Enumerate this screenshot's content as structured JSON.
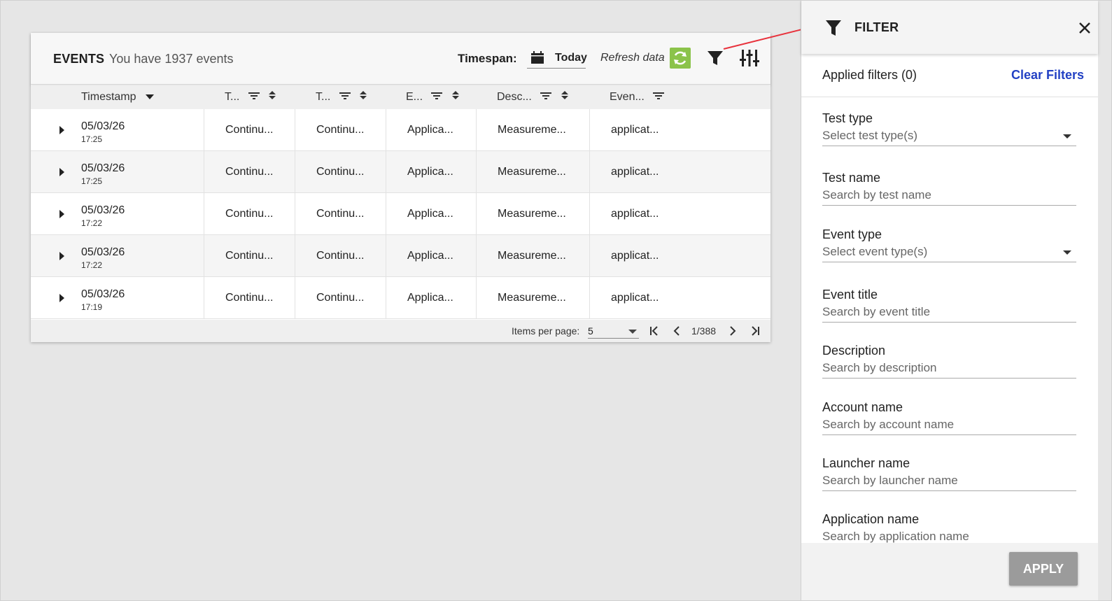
{
  "events": {
    "title": "EVENTS",
    "count_text": "You have 1937 events",
    "timespan_label": "Timespan:",
    "timespan_value": "Today",
    "refresh_label": "Refresh data"
  },
  "table": {
    "columns": [
      "Timestamp",
      "T...",
      "T...",
      "E...",
      "Desc...",
      "Even..."
    ],
    "rows": [
      {
        "date": "05/03/26",
        "time": "17:25",
        "c1": "Continu...",
        "c2": "Continu...",
        "c3": "Applica...",
        "c4": "Measureme...",
        "c5": "applicat..."
      },
      {
        "date": "05/03/26",
        "time": "17:25",
        "c1": "Continu...",
        "c2": "Continu...",
        "c3": "Applica...",
        "c4": "Measureme...",
        "c5": "applicat..."
      },
      {
        "date": "05/03/26",
        "time": "17:22",
        "c1": "Continu...",
        "c2": "Continu...",
        "c3": "Applica...",
        "c4": "Measureme...",
        "c5": "applicat..."
      },
      {
        "date": "05/03/26",
        "time": "17:22",
        "c1": "Continu...",
        "c2": "Continu...",
        "c3": "Applica...",
        "c4": "Measureme...",
        "c5": "applicat..."
      },
      {
        "date": "05/03/26",
        "time": "17:19",
        "c1": "Continu...",
        "c2": "Continu...",
        "c3": "Applica...",
        "c4": "Measureme...",
        "c5": "applicat..."
      }
    ]
  },
  "pagination": {
    "items_per_page_label": "Items per page:",
    "items_per_page_value": "5",
    "page_label": "1/388"
  },
  "filter_panel": {
    "title": "FILTER",
    "applied_label": "Applied filters (0)",
    "clear_label": "Clear Filters",
    "fields": [
      {
        "label": "Test type",
        "placeholder": "Select test type(s)"
      },
      {
        "label": "Test name",
        "placeholder": "Search by test name"
      },
      {
        "label": "Event type",
        "placeholder": "Select event type(s)"
      },
      {
        "label": "Event title",
        "placeholder": "Search by event title"
      },
      {
        "label": "Description",
        "placeholder": "Search by description"
      },
      {
        "label": "Account name",
        "placeholder": "Search by account name"
      },
      {
        "label": "Launcher name",
        "placeholder": "Search by launcher name"
      },
      {
        "label": "Application name",
        "placeholder": "Search by application name"
      }
    ],
    "apply_label": "APPLY"
  },
  "colors": {
    "accent_link": "#2341c4",
    "refresh_green": "#8bc34a",
    "annotation_arrow": "#e8323c",
    "apply_button": "#9b9b9b"
  }
}
